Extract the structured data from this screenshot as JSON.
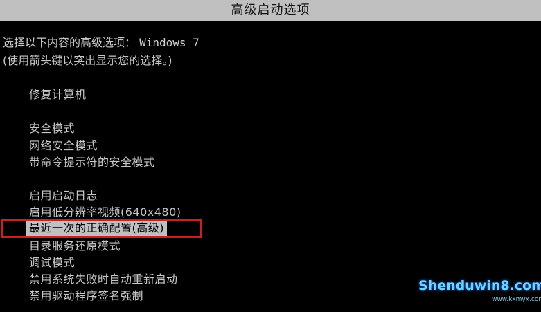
{
  "window": {
    "title": "高级启动选项"
  },
  "intro": {
    "line1_prefix": "选择以下内容的高级选项：",
    "line1_os": "Windows 7",
    "line2": "(使用箭头键以突出显示您的选择。)"
  },
  "menu": {
    "items": [
      "修复计算机",
      "安全模式",
      "网络安全模式",
      "带命令提示符的安全模式",
      "启用启动日志",
      "启用低分辨率视频(640x480)",
      "最近一次的正确配置(高级)",
      "目录服务还原模式",
      "调试模式",
      "禁用系统失败时自动重新启动",
      "禁用驱动程序签名强制"
    ],
    "selected_index": 6
  },
  "watermark": {
    "text": "Shenduwin8.com",
    "url": "www.kxmyx.com"
  },
  "colors": {
    "background": "#000000",
    "text": "#c8c8c8",
    "title_bar": "#c0c0c0",
    "selection_bg": "#c0c0c0",
    "highlight_box": "#cc1f1f"
  }
}
